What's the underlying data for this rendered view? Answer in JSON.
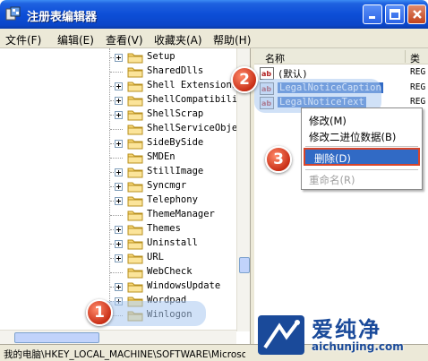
{
  "window": {
    "title": "注册表编辑器"
  },
  "menubar": {
    "items": [
      "文件(F)",
      "编辑(E)",
      "查看(V)",
      "收藏夹(A)",
      "帮助(H)"
    ]
  },
  "tree": {
    "items": [
      {
        "label": "Setup",
        "expander": true
      },
      {
        "label": "SharedDlls",
        "expander": false
      },
      {
        "label": "Shell Extensions",
        "expander": true
      },
      {
        "label": "ShellCompatibili",
        "expander": true
      },
      {
        "label": "ShellScrap",
        "expander": true
      },
      {
        "label": "ShellServiceObjec",
        "expander": false
      },
      {
        "label": "SideBySide",
        "expander": true
      },
      {
        "label": "SMDEn",
        "expander": false
      },
      {
        "label": "StillImage",
        "expander": true
      },
      {
        "label": "Syncmgr",
        "expander": true
      },
      {
        "label": "Telephony",
        "expander": true
      },
      {
        "label": "ThemeManager",
        "expander": false
      },
      {
        "label": "Themes",
        "expander": true
      },
      {
        "label": "Uninstall",
        "expander": true
      },
      {
        "label": "URL",
        "expander": true
      },
      {
        "label": "WebCheck",
        "expander": false
      },
      {
        "label": "WindowsUpdate",
        "expander": true
      },
      {
        "label": "Wordpad",
        "expander": true
      },
      {
        "label": "Winlogon",
        "expander": false
      }
    ]
  },
  "list": {
    "header_name": "名称",
    "header_type": "类",
    "rows": [
      {
        "label": "(默认)",
        "type": "REG",
        "selected": false
      },
      {
        "label": "LegalNoticeCaption",
        "type": "REG",
        "selected": true
      },
      {
        "label": "LegalNoticeText",
        "type": "REG",
        "selected": true
      }
    ]
  },
  "context_menu": {
    "items": [
      "修改(M)",
      "修改二进位数据(B)",
      "删除(D)",
      "重命名(R)"
    ]
  },
  "callouts": [
    "1",
    "2",
    "3"
  ],
  "statusbar": {
    "path": "我的电脑\\HKEY_LOCAL_MACHINE\\SOFTWARE\\Microsof"
  },
  "watermark": {
    "name": "爱纯净",
    "url": "aichunjing.com"
  },
  "colors": {
    "titlebar": "#0d4ed7",
    "selection": "#316ac5",
    "highlight_border": "#d8452a",
    "badge": "#c92f17"
  }
}
